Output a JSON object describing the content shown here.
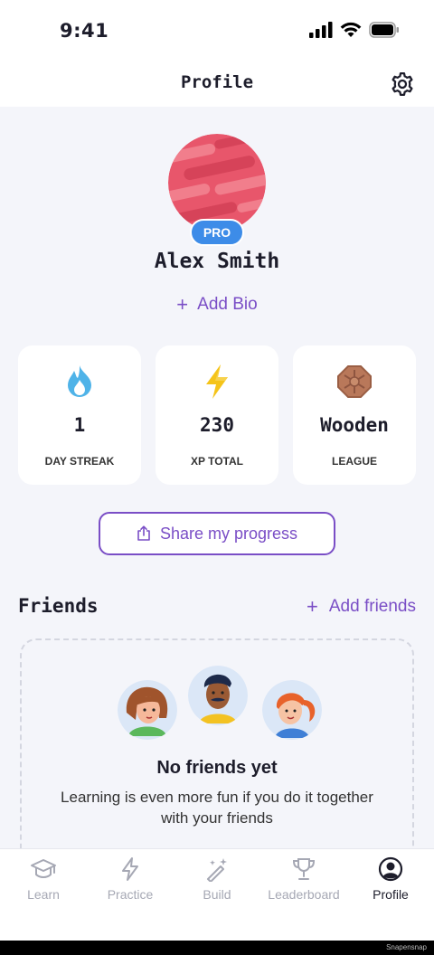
{
  "status_bar": {
    "time": "9:41"
  },
  "header": {
    "title": "Profile",
    "settings_icon": "gear-icon"
  },
  "profile": {
    "name": "Alex Smith",
    "badge": "PRO",
    "add_bio_label": "Add Bio"
  },
  "stats": [
    {
      "icon": "flame-icon",
      "value": "1",
      "label": "DAY STREAK"
    },
    {
      "icon": "lightning-icon",
      "value": "230",
      "label": "XP TOTAL"
    },
    {
      "icon": "wooden-badge-icon",
      "value": "Wooden",
      "label": "LEAGUE"
    }
  ],
  "share_button": {
    "label": "Share my progress",
    "icon": "share-icon"
  },
  "friends": {
    "title": "Friends",
    "add_label": "Add friends",
    "empty_title": "No friends yet",
    "empty_text": "Learning is even more fun if you do it together with your friends"
  },
  "tabs": [
    {
      "label": "Learn",
      "icon": "graduation-cap-icon",
      "active": false
    },
    {
      "label": "Practice",
      "icon": "lightning-outline-icon",
      "active": false
    },
    {
      "label": "Build",
      "icon": "magic-wand-icon",
      "active": false
    },
    {
      "label": "Leaderboard",
      "icon": "trophy-icon",
      "active": false
    },
    {
      "label": "Profile",
      "icon": "user-circle-icon",
      "active": true
    }
  ],
  "watermark": "Snapensnap",
  "colors": {
    "accent": "#7a4ec6",
    "pro_badge": "#3d8ce8",
    "background": "#f4f5fa"
  }
}
